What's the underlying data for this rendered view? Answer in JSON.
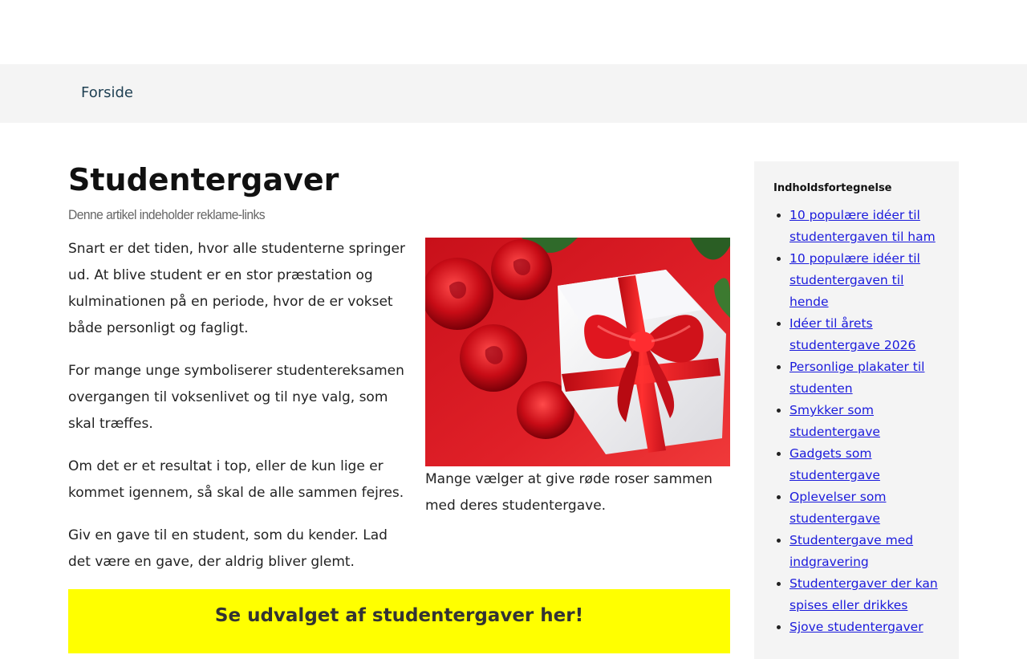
{
  "nav": {
    "items": [
      {
        "label": "Forside"
      }
    ]
  },
  "article": {
    "title": "Studentergaver",
    "ad_note": "Denne artikel indeholder reklame-links",
    "paragraphs": [
      "Snart er det tiden, hvor alle studenterne springer ud. At blive student er en stor præstation og kulminationen på en periode, hvor de er vokset både personligt og fagligt.",
      "For mange unge symboliserer studentereksamen overgangen til voksenlivet og til nye valg, som skal træffes.",
      "Om det er et resultat i top, eller de kun lige er kommet igennem, så skal de alle sammen fejres.",
      "Giv en gave til en student, som du kender. Lad det være en gave, der aldrig bliver glemt."
    ],
    "image_caption": "Mange vælger at give røde roser sammen med deres studentergave.",
    "cta_label": "Se udvalget af studentergaver her!"
  },
  "toc": {
    "title": "Indholdsfortegnelse",
    "items": [
      "10 populære idéer til studentergaven til ham",
      "10 populære idéer til studentergaven til hende",
      "Idéer til årets studentergave 2026",
      "Personlige plakater til studenten",
      "Smykker som studentergave",
      "Gadgets som studentergave",
      "Oplevelser som studentergave",
      "Studentergave med indgravering",
      "Studentergaver der kan spises eller drikkes",
      "Sjove studentergaver"
    ]
  },
  "colors": {
    "link": "#1a1adc",
    "cta_background": "#ffff00",
    "nav_background": "#f4f4f4",
    "sidebar_background": "#f4f4f4"
  }
}
